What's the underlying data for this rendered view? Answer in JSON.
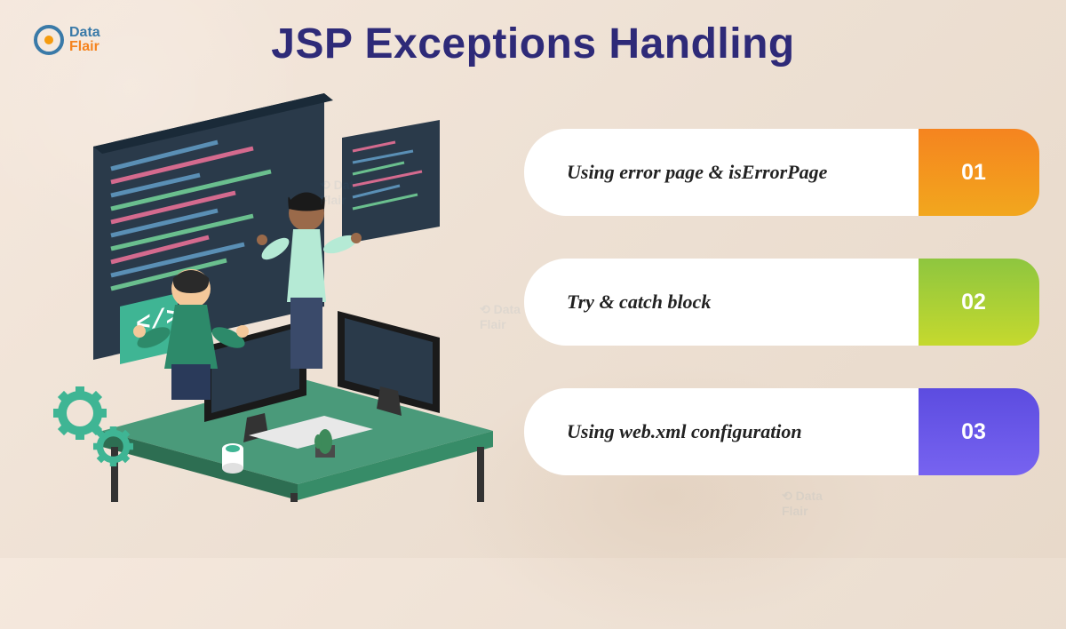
{
  "logo": {
    "top": "Data",
    "bottom": "Flair"
  },
  "title": "JSP Exceptions Handling",
  "items": [
    {
      "label": "Using error page & isErrorPage",
      "number": "01",
      "colorClass": "num-1"
    },
    {
      "label": "Try & catch block",
      "number": "02",
      "colorClass": "num-2"
    },
    {
      "label": "Using web.xml configuration",
      "number": "03",
      "colorClass": "num-3"
    }
  ]
}
